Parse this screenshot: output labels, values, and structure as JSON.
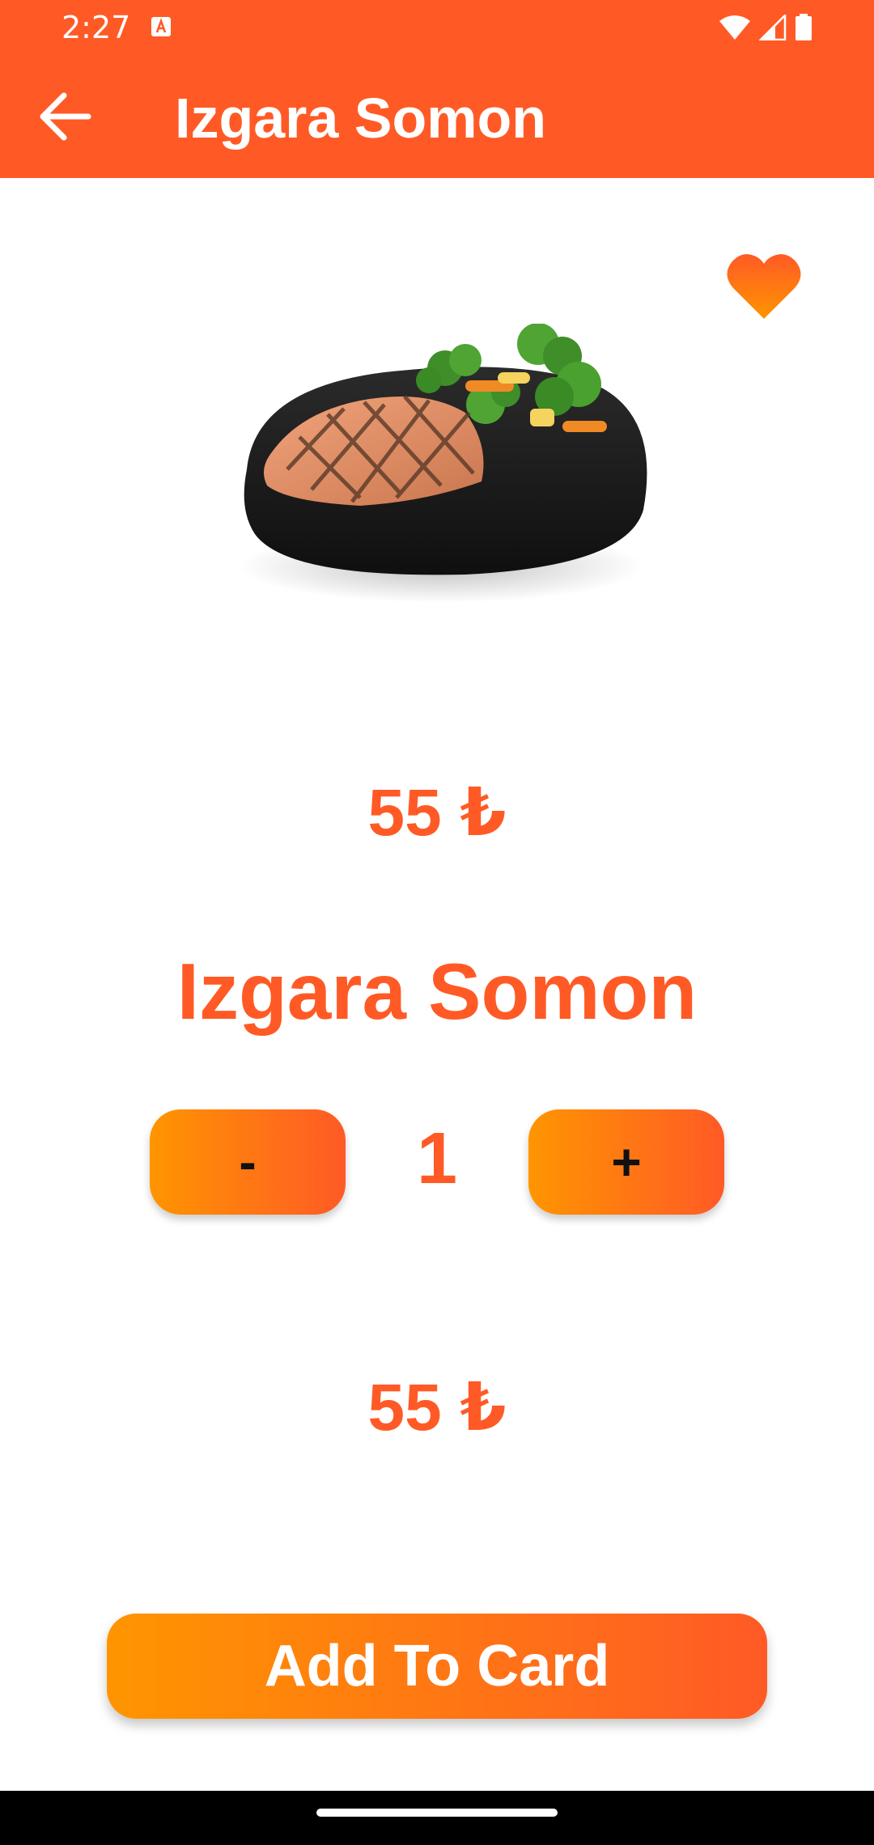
{
  "status_bar": {
    "time": "2:27",
    "icons": [
      "a-notification-icon",
      "wifi-icon",
      "signal-icon",
      "battery-icon"
    ]
  },
  "app_bar": {
    "back_icon": "arrow-left-icon",
    "title": "Izgara Somon"
  },
  "product": {
    "favorite_icon": "heart-icon",
    "image_description_icon": "grilled-salmon-plate-image",
    "unit_price": "55 ₺",
    "name": "Izgara Somon"
  },
  "quantity": {
    "minus_label": "-",
    "value": "1",
    "plus_label": "+"
  },
  "total_price": "55 ₺",
  "cta": {
    "label": "Add To Card"
  },
  "colors": {
    "primary": "#FF5A26",
    "gradient_start": "#FF9500",
    "gradient_end": "#FF5A26",
    "text_on_primary": "#FFFFFF"
  }
}
